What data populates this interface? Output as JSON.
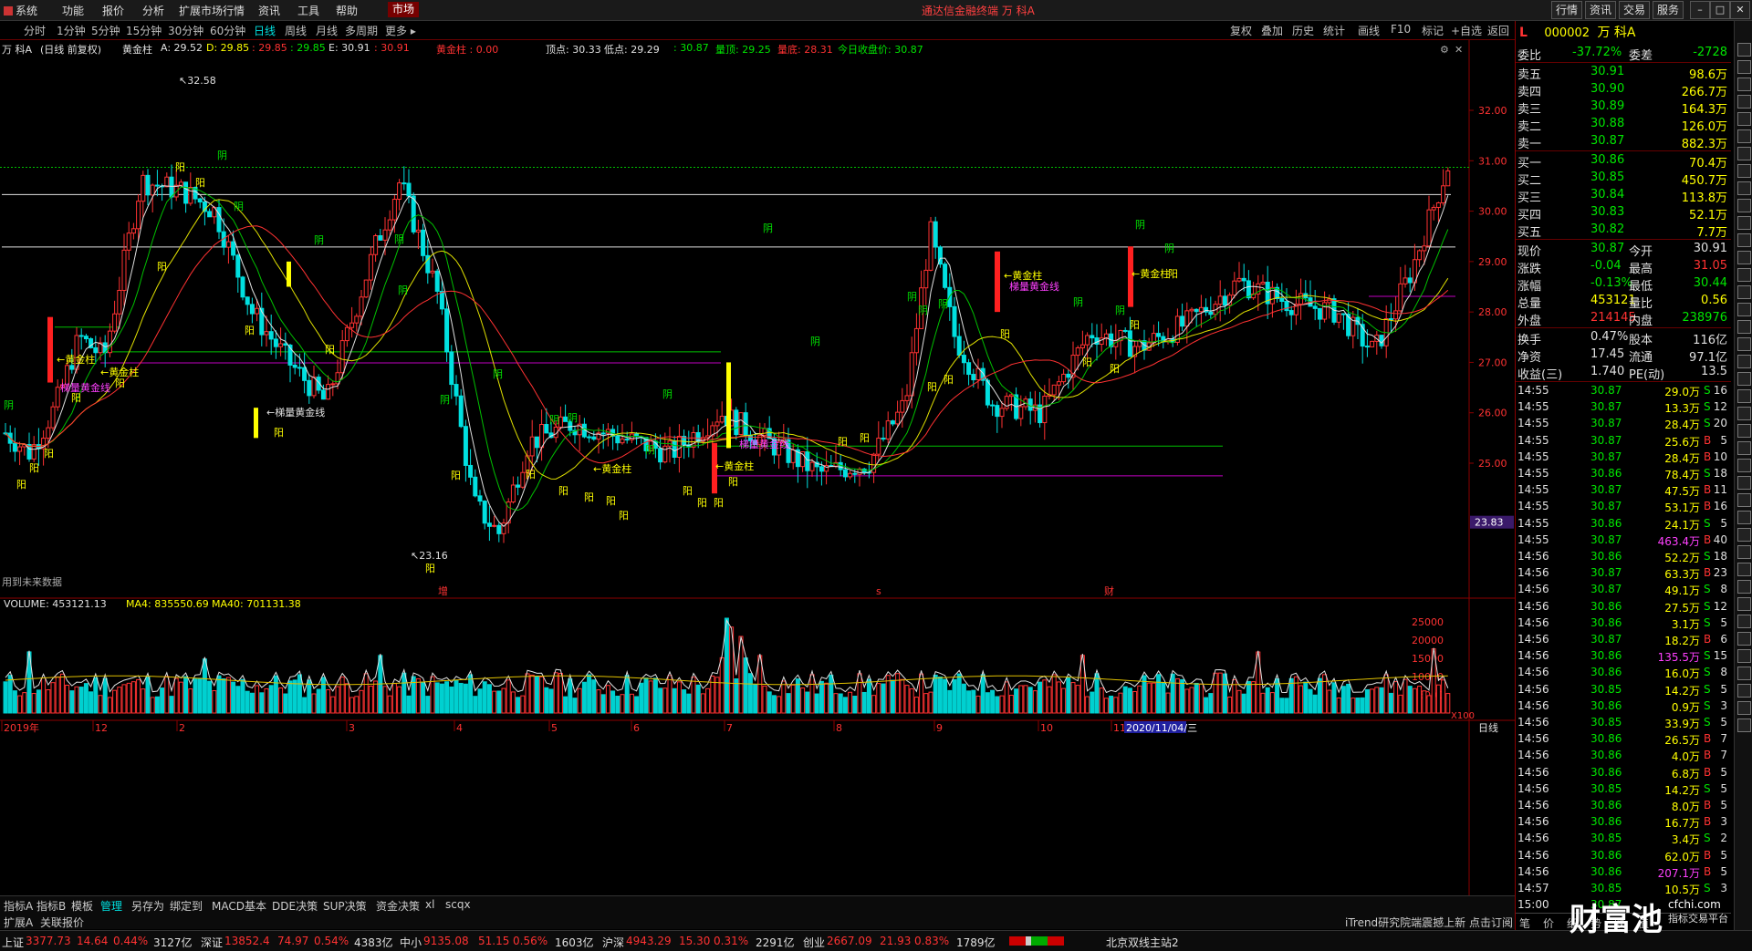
{
  "menu": {
    "items": [
      "系统",
      "功能",
      "报价",
      "分析",
      "扩展市场行情",
      "资讯",
      "工具",
      "帮助"
    ],
    "market_label": "市场",
    "app_title": "通达信金融终端  万 科A",
    "right_buttons": [
      "行情",
      "资讯",
      "交易",
      "服务"
    ]
  },
  "periods": [
    "分时",
    "1分钟",
    "5分钟",
    "15分钟",
    "30分钟",
    "60分钟",
    "日线",
    "周线",
    "月线",
    "多周期",
    "更多 ▸"
  ],
  "active_period": "日线",
  "toolbar": [
    "复权",
    "叠加",
    "历史",
    "统计",
    "画线",
    "F10",
    "标记",
    "+自选",
    "返回"
  ],
  "info": {
    "stock": "万 科A",
    "mode": "(日线 前复权)",
    "indicator": "黄金柱",
    "A": "A: 29.52",
    "D": "D: 29.85",
    "E1": ": 29.85",
    "E2": ": 29.85",
    "E": "E: 30.91",
    "v1": ": 30.91",
    "gold_label": "黄金柱 : 0.00",
    "top": "顶点: 30.33",
    "low": "低点: 29.29",
    "v2": ": 30.87",
    "peak": "量顶: 29.25",
    "bottom": "量底: 28.31",
    "today_close": "今日收盘价: 30.87"
  },
  "price_axis": [
    "32.00",
    "31.00",
    "30.00",
    "29.00",
    "28.00",
    "27.00",
    "26.00",
    "25.00"
  ],
  "price_tag": "23.83",
  "annotations": {
    "high": "32.58",
    "low": "23.16",
    "future": "用到未来数据",
    "gold": "黄金柱",
    "ladder": "梯量黄金线",
    "yin": "阴",
    "yang": "阳",
    "zeng": "增",
    "s": "s",
    "cai": "财"
  },
  "volume": {
    "title": "VOLUME: 453121.13",
    "ma4": "MA4: 835550.69",
    "ma40": "MA40: 701131.38",
    "axis": [
      "25000",
      "20000",
      "15000",
      "10000",
      "5000"
    ],
    "unit": "X100"
  },
  "x_axis": [
    "2019年",
    "12",
    "2",
    "3",
    "4",
    "5",
    "6",
    "7",
    "8",
    "9",
    "10",
    "11"
  ],
  "date_box": "2020/11/04/三",
  "period_label": "日线",
  "tabs": [
    "指标A",
    "指标B",
    "模板",
    "管理",
    "另存为",
    "绑定到",
    "MACD基本",
    "DDE决策",
    "SUP决策",
    "资金决策",
    "xl",
    "scqx"
  ],
  "tabs2": [
    "扩展A",
    "关联报价"
  ],
  "quote": {
    "code": "000002",
    "name": "万 科A",
    "weibi_label": "委比",
    "weibi": "-37.72%",
    "weicha_label": "委差",
    "weicha": "-2728",
    "asks": [
      {
        "label": "卖五",
        "price": "30.91",
        "vol": "98.6万"
      },
      {
        "label": "卖四",
        "price": "30.90",
        "vol": "266.7万"
      },
      {
        "label": "卖三",
        "price": "30.89",
        "vol": "164.3万"
      },
      {
        "label": "卖二",
        "price": "30.88",
        "vol": "126.0万"
      },
      {
        "label": "卖一",
        "price": "30.87",
        "vol": "882.3万"
      }
    ],
    "bids": [
      {
        "label": "买一",
        "price": "30.86",
        "vol": "70.4万"
      },
      {
        "label": "买二",
        "price": "30.85",
        "vol": "450.7万"
      },
      {
        "label": "买三",
        "price": "30.84",
        "vol": "113.8万"
      },
      {
        "label": "买四",
        "price": "30.83",
        "vol": "52.1万"
      },
      {
        "label": "买五",
        "price": "30.82",
        "vol": "7.7万"
      }
    ],
    "stats": [
      {
        "l1": "现价",
        "v1": "30.87",
        "l2": "今开",
        "v2": "30.91"
      },
      {
        "l1": "涨跌",
        "v1": "-0.04",
        "l2": "最高",
        "v2": "31.05"
      },
      {
        "l1": "涨幅",
        "v1": "-0.13%",
        "l2": "最低",
        "v2": "30.44"
      },
      {
        "l1": "总量",
        "v1": "453121",
        "l2": "量比",
        "v2": "0.56"
      },
      {
        "l1": "外盘",
        "v1": "214145",
        "l2": "内盘",
        "v2": "238976"
      },
      {
        "l1": "换手",
        "v1": "0.47%",
        "l2": "股本",
        "v2": "116亿"
      },
      {
        "l1": "净资",
        "v1": "17.45",
        "l2": "流通",
        "v2": "97.1亿"
      },
      {
        "l1": "收益(三)",
        "v1": "1.740",
        "l2": "PE(动)",
        "v2": "13.5"
      }
    ],
    "ticks": [
      [
        "14:55",
        "30.87",
        "29.0万",
        "S",
        "16"
      ],
      [
        "14:55",
        "30.87",
        "13.3万",
        "S",
        "12"
      ],
      [
        "14:55",
        "30.87",
        "28.4万",
        "S",
        "20"
      ],
      [
        "14:55",
        "30.87",
        "25.6万",
        "B",
        "5"
      ],
      [
        "14:55",
        "30.87",
        "28.4万",
        "B",
        "10"
      ],
      [
        "14:55",
        "30.86",
        "78.4万",
        "S",
        "18"
      ],
      [
        "14:55",
        "30.87",
        "47.5万",
        "B",
        "11"
      ],
      [
        "14:55",
        "30.87",
        "53.1万",
        "B",
        "16"
      ],
      [
        "14:55",
        "30.86",
        "24.1万",
        "S",
        "5"
      ],
      [
        "14:55",
        "30.87",
        "463.4万",
        "B",
        "40"
      ],
      [
        "14:56",
        "30.86",
        "52.2万",
        "S",
        "18"
      ],
      [
        "14:56",
        "30.87",
        "63.3万",
        "B",
        "23"
      ],
      [
        "14:56",
        "30.87",
        "49.1万",
        "S",
        "8"
      ],
      [
        "14:56",
        "30.86",
        "27.5万",
        "S",
        "12"
      ],
      [
        "14:56",
        "30.86",
        "3.1万",
        "S",
        "5"
      ],
      [
        "14:56",
        "30.87",
        "18.2万",
        "B",
        "6"
      ],
      [
        "14:56",
        "30.86",
        "135.5万",
        "S",
        "15"
      ],
      [
        "14:56",
        "30.86",
        "16.0万",
        "S",
        "8"
      ],
      [
        "14:56",
        "30.85",
        "14.2万",
        "S",
        "5"
      ],
      [
        "14:56",
        "30.86",
        "0.9万",
        "S",
        "3"
      ],
      [
        "14:56",
        "30.85",
        "33.9万",
        "S",
        "5"
      ],
      [
        "14:56",
        "30.86",
        "26.5万",
        "B",
        "7"
      ],
      [
        "14:56",
        "30.86",
        "4.0万",
        "B",
        "7"
      ],
      [
        "14:56",
        "30.86",
        "6.8万",
        "B",
        "5"
      ],
      [
        "14:56",
        "30.85",
        "14.2万",
        "S",
        "5"
      ],
      [
        "14:56",
        "30.86",
        "8.0万",
        "B",
        "5"
      ],
      [
        "14:56",
        "30.86",
        "16.7万",
        "B",
        "3"
      ],
      [
        "14:56",
        "30.85",
        "3.4万",
        "S",
        "2"
      ],
      [
        "14:56",
        "30.86",
        "62.0万",
        "B",
        "5"
      ],
      [
        "14:56",
        "30.86",
        "207.1万",
        "B",
        "5"
      ],
      [
        "14:57",
        "30.85",
        "10.5万",
        "S",
        "3"
      ],
      [
        "15:00",
        "30.87",
        "",
        "",
        ""
      ]
    ],
    "bottom_tabs": [
      "笔",
      "价",
      "细",
      "势",
      "联",
      "值"
    ]
  },
  "status": {
    "sh_label": "上证",
    "sh": "3377.73",
    "sh_chg": "14.64",
    "sh_pct": "0.44%",
    "sh_amt": "3127亿",
    "sz_label": "深证",
    "sz": "13852.4",
    "sz_chg": "74.97",
    "sz_pct": "0.54%",
    "sz_amt": "4383亿",
    "zx_label": "中小",
    "zx": "9135.08",
    "zx_chg": "51.15",
    "zx_pct": "0.56%",
    "zx_amt": "1603亿",
    "hs_label": "沪深",
    "hs": "4943.29",
    "hs_chg": "15.30",
    "hs_pct": "0.31%",
    "hs_amt": "2291亿",
    "cy_label": "创业",
    "cy": "2667.09",
    "cy_chg": "21.93",
    "cy_pct": "0.83%",
    "cy_amt": "1789亿",
    "server": "北京双线主站2",
    "news": "iTrend研究院端震撼上新 点击订阅",
    "brand": "财富池",
    "brand_url": "cfchi.com",
    "brand_sub": "指标交易平台"
  }
}
